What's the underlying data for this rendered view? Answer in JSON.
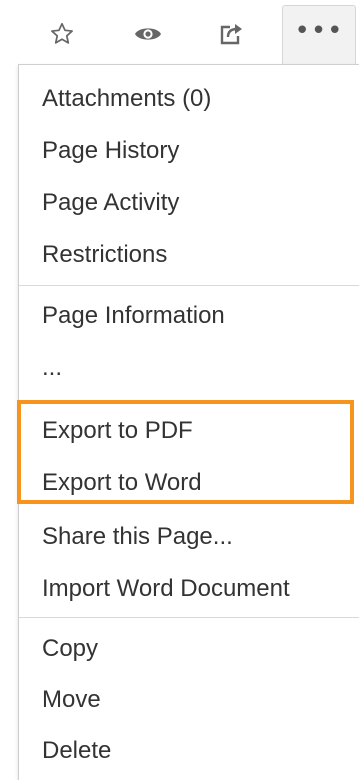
{
  "toolbar": {
    "more_label": "•••"
  },
  "menu": {
    "group1": [
      "Attachments (0)",
      "Page History",
      "Page Activity",
      "Restrictions"
    ],
    "group2": [
      "Page Information",
      "...",
      "Export to PDF",
      "Export to Word",
      "Share this Page...",
      "Import Word Document"
    ],
    "group3": [
      "Copy",
      "Move",
      "Delete"
    ]
  },
  "colors": {
    "highlight": "#f7941d",
    "text": "#333333",
    "icon": "#666666"
  }
}
